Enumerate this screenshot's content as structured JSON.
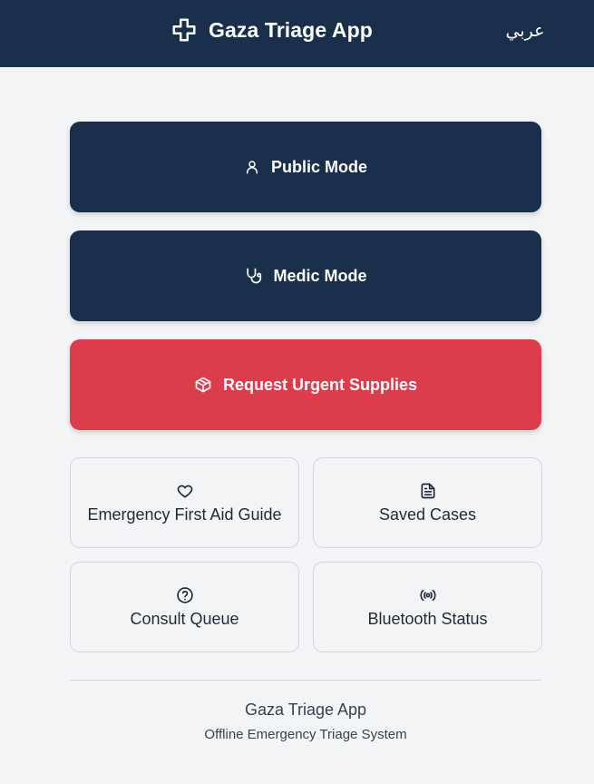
{
  "header": {
    "title": "Gaza Triage App",
    "language_toggle": "عربي",
    "logo_icon": "medical-cross-icon",
    "background": "#1a2f4b"
  },
  "main_actions": [
    {
      "label": "Public Mode",
      "icon": "user-icon",
      "color": "#1a2f4b"
    },
    {
      "label": "Medic Mode",
      "icon": "stethoscope-icon",
      "color": "#1a2f4b"
    },
    {
      "label": "Request Urgent Supplies",
      "icon": "package-icon",
      "color": "#dd3c4b"
    }
  ],
  "tiles": [
    {
      "label": "Emergency First Aid Guide",
      "icon": "heart-icon"
    },
    {
      "label": "Saved Cases",
      "icon": "document-icon"
    },
    {
      "label": "Consult Queue",
      "icon": "help-circle-icon"
    },
    {
      "label": "Bluetooth Status",
      "icon": "broadcast-icon"
    }
  ],
  "footer": {
    "title": "Gaza Triage App",
    "subtitle": "Offline Emergency Triage System"
  }
}
